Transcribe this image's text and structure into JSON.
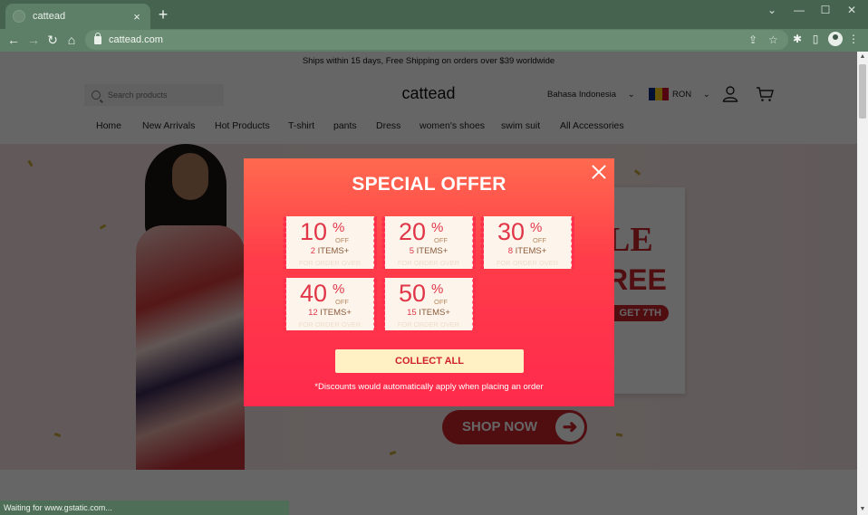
{
  "browser": {
    "tab_title": "cattead",
    "tab_close": "×",
    "new_tab": "+",
    "url": "cattead.com",
    "window_controls": {
      "dropdown": "⌄",
      "minimize": "—",
      "maximize": "☐",
      "close": "✕"
    },
    "nav": {
      "back": "←",
      "forward": "→",
      "reload": "↻",
      "home": "⌂"
    },
    "toolbar_icons": {
      "share": "⇪",
      "bookmark": "☆",
      "extensions": "✱",
      "sidepanel": "▯",
      "menu": "⋮"
    },
    "status_text": "Waiting for www.gstatic.com..."
  },
  "site": {
    "shipping_banner": "Ships within 15 days, Free Shipping on orders over $39 worldwide",
    "search_placeholder": "Search products",
    "logo": "cattead",
    "language": "Bahasa Indonesia",
    "currency": "RON",
    "chevron": "⌄",
    "flag_colors": [
      "#002b7f",
      "#fcd116",
      "#ce1126"
    ],
    "nav": [
      "Home",
      "New Arrivals",
      "Hot Products",
      "T-shirt",
      "pants",
      "Dress",
      "women's shoes",
      "swim suit",
      "All Accessories"
    ],
    "hero": {
      "sale_big": "LE",
      "sale_free": "REE",
      "sale_pill": "GET 7TH",
      "shop_now": "SHOP NOW",
      "arrow": "➜"
    }
  },
  "modal": {
    "title": "SPECIAL OFFER",
    "close": "×",
    "coupons": [
      {
        "percent": "10",
        "symbol": "%",
        "off": "OFF",
        "items_num": "2",
        "items_text": " ITEMS+",
        "condition": "FOR ORDER OVER"
      },
      {
        "percent": "20",
        "symbol": "%",
        "off": "OFF",
        "items_num": "5",
        "items_text": " ITEMS+",
        "condition": "FOR ORDER OVER"
      },
      {
        "percent": "30",
        "symbol": "%",
        "off": "OFF",
        "items_num": "8",
        "items_text": " ITEMS+",
        "condition": "FOR ORDER OVER"
      },
      {
        "percent": "40",
        "symbol": "%",
        "off": "OFF",
        "items_num": "12",
        "items_text": " ITEMS+",
        "condition": "FOR ORDER OVER"
      },
      {
        "percent": "50",
        "symbol": "%",
        "off": "OFF",
        "items_num": "15",
        "items_text": " ITEMS+",
        "condition": "FOR ORDER OVER"
      }
    ],
    "collect_label": "COLLECT ALL",
    "note": "*Discounts would automatically apply when placing an order",
    "colors": {
      "gradient_top": "#ff6a4f",
      "gradient_bottom": "#ff2a4c",
      "button_bg": "#fff1c4",
      "button_text": "#d0202e",
      "coupon_bg": "#fdf5ec",
      "coupon_number": "#e13548"
    }
  }
}
